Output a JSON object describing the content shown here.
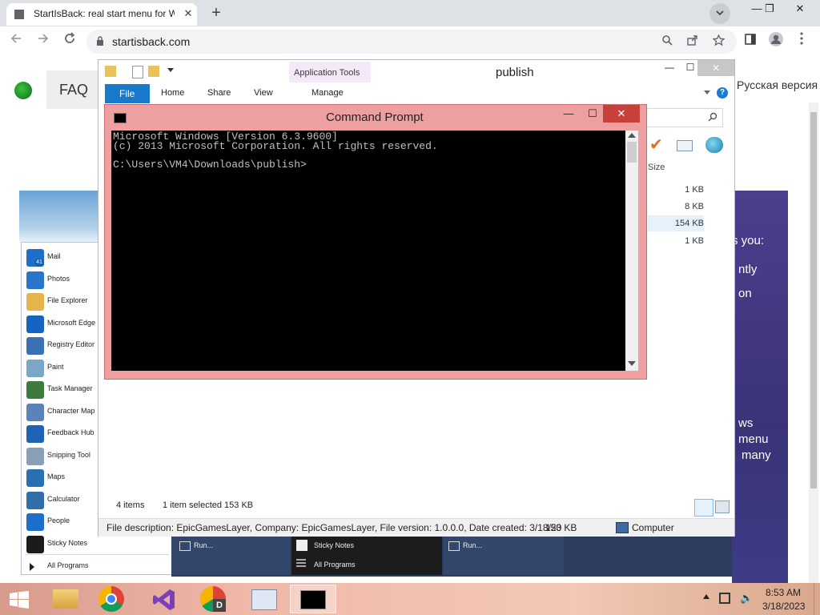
{
  "browser": {
    "tab_title": "StartIsBack: real start menu for W",
    "url": "startisback.com",
    "new_tab": "+",
    "tab_close": "✕",
    "win_minimize": "—",
    "win_restore": "❐",
    "win_close": "✕"
  },
  "site": {
    "faq": "FAQ",
    "language": "Русская версия",
    "panel_lines": [
      "s you:",
      "ntly",
      "on",
      "ws",
      "menu",
      "many"
    ]
  },
  "startmenu": {
    "items": [
      {
        "label": "Mail",
        "icon": "mail-icon",
        "color": "#1e6fc9"
      },
      {
        "label": "Photos",
        "icon": "photos-icon",
        "color": "#2a74c9"
      },
      {
        "label": "File Explorer",
        "icon": "folder-icon",
        "color": "#e3b54a"
      },
      {
        "label": "Microsoft Edge",
        "icon": "edge-icon",
        "color": "#1565c0"
      },
      {
        "label": "Registry Editor",
        "icon": "registry-icon",
        "color": "#3b6fb6"
      },
      {
        "label": "Paint",
        "icon": "paint-icon",
        "color": "#7aa7c7"
      },
      {
        "label": "Task Manager",
        "icon": "task-manager-icon",
        "color": "#3d7a3d"
      },
      {
        "label": "Character Map",
        "icon": "character-map-icon",
        "color": "#5a84b8"
      },
      {
        "label": "Feedback Hub",
        "icon": "feedback-icon",
        "color": "#1e63b5"
      },
      {
        "label": "Snipping Tool",
        "icon": "scissors-icon",
        "color": "#8aa0b8"
      },
      {
        "label": "Maps",
        "icon": "maps-icon",
        "color": "#2b6fb3"
      },
      {
        "label": "Calculator",
        "icon": "calculator-icon",
        "color": "#2f6ea8"
      },
      {
        "label": "People",
        "icon": "people-icon",
        "color": "#1e6fc9"
      },
      {
        "label": "Sticky Notes",
        "icon": "sticky-notes-icon",
        "color": "#1b1b1b"
      }
    ],
    "all_programs": "All Programs",
    "mail_badge": "41"
  },
  "demo_taskbar": {
    "run1": "Run...",
    "sticky": "Sticky Notes",
    "all_programs": "All Programs",
    "run2": "Run..."
  },
  "explorer": {
    "title": "publish",
    "app_tools": "Application Tools",
    "tabs": {
      "file": "File",
      "home": "Home",
      "share": "Share",
      "view": "View",
      "manage": "Manage"
    },
    "size_header": "Size",
    "sizes": [
      "1 KB",
      "8 KB",
      "154 KB",
      "1 KB"
    ],
    "status_items": "4 items",
    "status_selected": "1 item selected  153 KB",
    "description": "File description: EpicGamesLayer, Company: EpicGamesLayer, File version: 1.0.0.0, Date created: 3/18/20",
    "desc_size": "153 KB",
    "computer": "Computer"
  },
  "cmd": {
    "title": "Command Prompt",
    "lines": [
      "Microsoft Windows [Version 6.3.9600]",
      "(c) 2013 Microsoft Corporation. All rights reserved.",
      "",
      "C:\\Users\\VM4\\Downloads\\publish>"
    ],
    "icon_text": "C:\\"
  },
  "taskbar": {
    "time": "8:53 AM",
    "date": "3/18/2023"
  }
}
